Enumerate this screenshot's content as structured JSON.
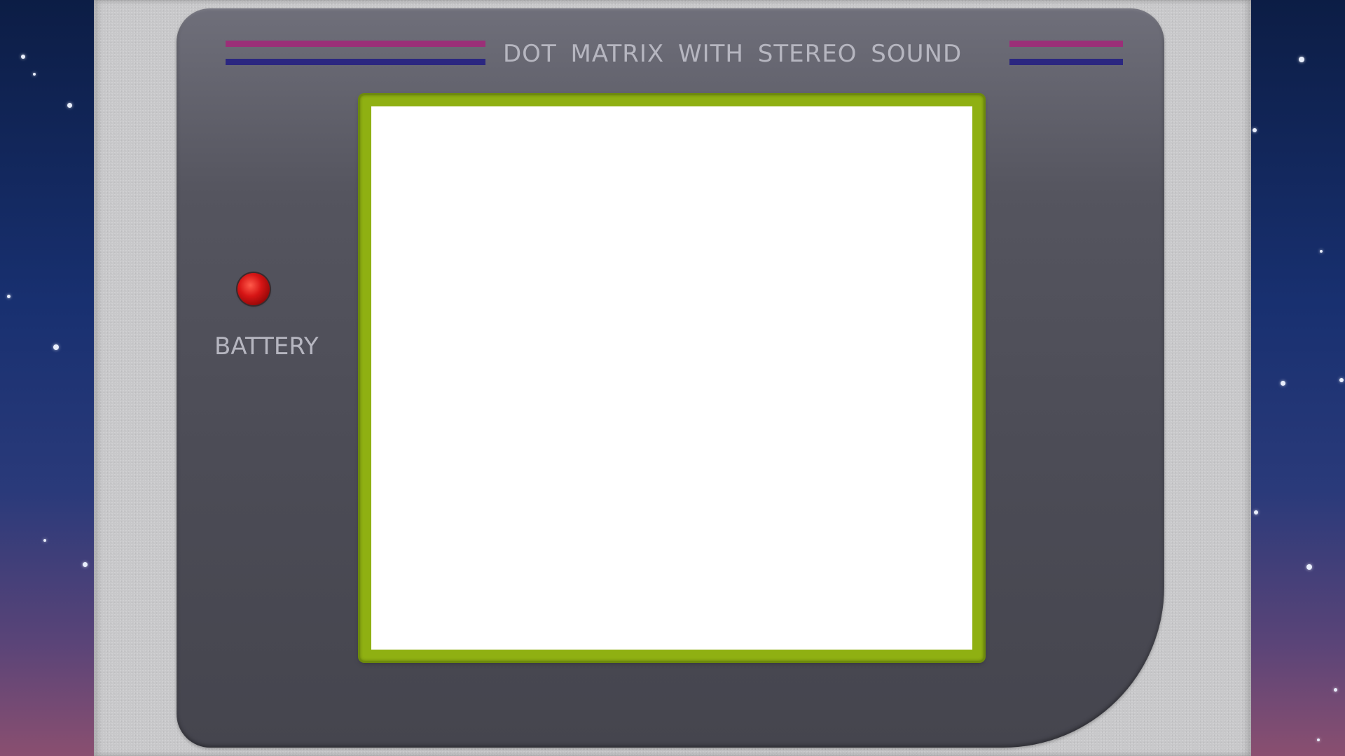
{
  "console": {
    "header_text": "DOT MATRIX WITH STEREO SOUND",
    "battery_label": "BATTERY",
    "battery_led_state": "on",
    "colors": {
      "stripe_magenta": "#9b2f78",
      "stripe_navy": "#2b2780",
      "screen_border": "#8fb012",
      "screen_fill": "#ffffff",
      "bezel": "#4c4c56",
      "body": "#c8c8ca",
      "battery_led": "#d61515"
    }
  }
}
